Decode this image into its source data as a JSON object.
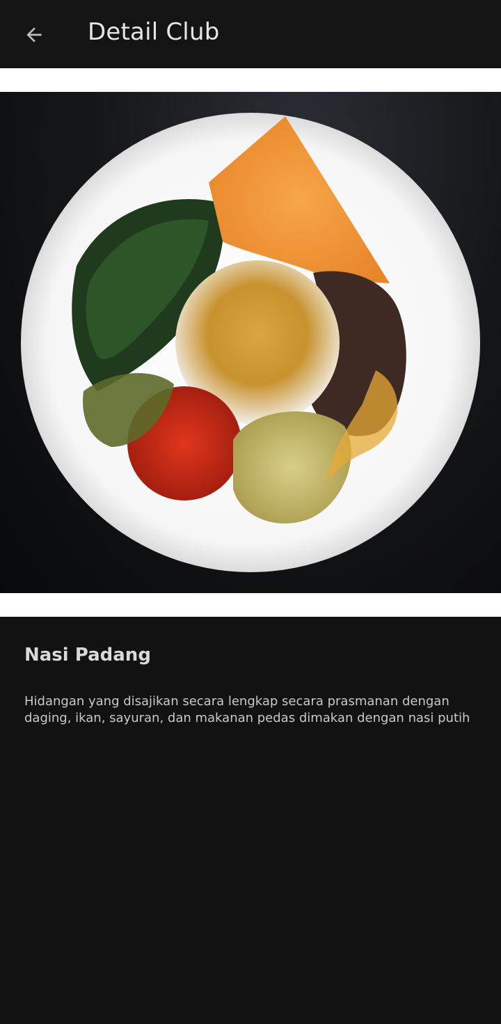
{
  "app_bar": {
    "title": "Detail Club",
    "back_icon": "arrow-left-icon"
  },
  "detail": {
    "image_subject": "food-photo",
    "name": "Nasi Padang",
    "description": "Hidangan yang disajikan secara lengkap secara prasmanan dengan daging, ikan, sayuran, dan makanan pedas dimakan dengan nasi putih"
  },
  "colors": {
    "background": "#121212",
    "app_bar": "#141414",
    "title_text": "#e6e6e6",
    "body_text": "#c9c9c9"
  }
}
